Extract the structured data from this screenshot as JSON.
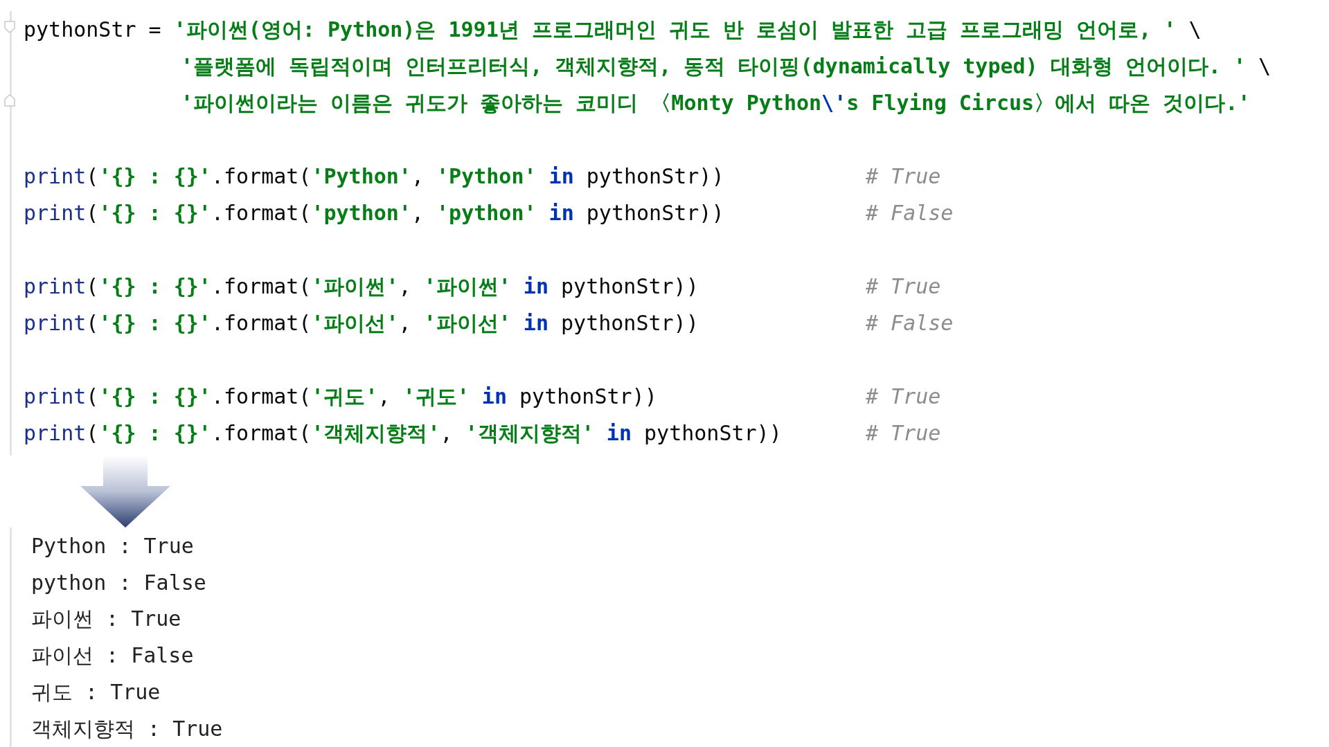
{
  "editor": {
    "blocks": [
      {
        "lines": [
          {
            "fold_start": true,
            "tokens": [
              {
                "kind": "plain",
                "text": "pythonStr = "
              },
              {
                "kind": "string",
                "text": "'파이썬(영어: Python)은 1991년 프로그래머인 귀도 반 로섬이 발표한 고급 프로그래밍 언어로, '"
              },
              {
                "kind": "plain",
                "text": " \\"
              }
            ],
            "children": [
              {
                "tokens": [
                  {
                    "kind": "string",
                    "text": "'플랫폼에 독립적이며 인터프리터식, 객체지향적, 동적 타이핑(dynamically typed) 대화형 언어이다. '"
                  },
                  {
                    "kind": "plain",
                    "text": " \\"
                  }
                ]
              },
              {
                "fold_end": true,
                "tokens": [
                  {
                    "kind": "string",
                    "text": "'파이썬이라는 이름은 귀도가 좋아하는 코미디 〈Monty Python"
                  },
                  {
                    "kind": "escape",
                    "text": "\\'"
                  },
                  {
                    "kind": "string",
                    "text": "s Flying Circus〉에서 따온 것이다.'"
                  }
                ]
              }
            ]
          }
        ]
      },
      {
        "lines": [
          {
            "tokens": [
              {
                "kind": "builtin",
                "text": "print"
              },
              {
                "kind": "plain",
                "text": "("
              },
              {
                "kind": "string",
                "text": "'{} : {}'"
              },
              {
                "kind": "plain",
                "text": ".format("
              },
              {
                "kind": "string",
                "text": "'Python'"
              },
              {
                "kind": "plain",
                "text": ", "
              },
              {
                "kind": "string",
                "text": "'Python'"
              },
              {
                "kind": "keyword",
                "text": " in"
              },
              {
                "kind": "plain",
                "text": " pythonStr))"
              }
            ],
            "comment": "# True"
          },
          {
            "tokens": [
              {
                "kind": "builtin",
                "text": "print"
              },
              {
                "kind": "plain",
                "text": "("
              },
              {
                "kind": "string",
                "text": "'{} : {}'"
              },
              {
                "kind": "plain",
                "text": ".format("
              },
              {
                "kind": "string",
                "text": "'python'"
              },
              {
                "kind": "plain",
                "text": ", "
              },
              {
                "kind": "string",
                "text": "'python'"
              },
              {
                "kind": "keyword",
                "text": " in"
              },
              {
                "kind": "plain",
                "text": " pythonStr))"
              }
            ],
            "comment": "# False"
          }
        ]
      },
      {
        "lines": [
          {
            "tokens": [
              {
                "kind": "builtin",
                "text": "print"
              },
              {
                "kind": "plain",
                "text": "("
              },
              {
                "kind": "string",
                "text": "'{} : {}'"
              },
              {
                "kind": "plain",
                "text": ".format("
              },
              {
                "kind": "string",
                "text": "'파이썬'"
              },
              {
                "kind": "plain",
                "text": ", "
              },
              {
                "kind": "string",
                "text": "'파이썬'"
              },
              {
                "kind": "keyword",
                "text": " in"
              },
              {
                "kind": "plain",
                "text": " pythonStr))"
              }
            ],
            "comment": "# True"
          },
          {
            "tokens": [
              {
                "kind": "builtin",
                "text": "print"
              },
              {
                "kind": "plain",
                "text": "("
              },
              {
                "kind": "string",
                "text": "'{} : {}'"
              },
              {
                "kind": "plain",
                "text": ".format("
              },
              {
                "kind": "string",
                "text": "'파이선'"
              },
              {
                "kind": "plain",
                "text": ", "
              },
              {
                "kind": "string",
                "text": "'파이선'"
              },
              {
                "kind": "keyword",
                "text": " in"
              },
              {
                "kind": "plain",
                "text": " pythonStr))"
              }
            ],
            "comment": "# False"
          }
        ]
      },
      {
        "lines": [
          {
            "tokens": [
              {
                "kind": "builtin",
                "text": "print"
              },
              {
                "kind": "plain",
                "text": "("
              },
              {
                "kind": "string",
                "text": "'{} : {}'"
              },
              {
                "kind": "plain",
                "text": ".format("
              },
              {
                "kind": "string",
                "text": "'귀도'"
              },
              {
                "kind": "plain",
                "text": ", "
              },
              {
                "kind": "string",
                "text": "'귀도'"
              },
              {
                "kind": "keyword",
                "text": " in"
              },
              {
                "kind": "plain",
                "text": " pythonStr))"
              }
            ],
            "comment": "# True"
          },
          {
            "tokens": [
              {
                "kind": "builtin",
                "text": "print"
              },
              {
                "kind": "plain",
                "text": "("
              },
              {
                "kind": "string",
                "text": "'{} : {}'"
              },
              {
                "kind": "plain",
                "text": ".format("
              },
              {
                "kind": "string",
                "text": "'객체지향적'"
              },
              {
                "kind": "plain",
                "text": ", "
              },
              {
                "kind": "string",
                "text": "'객체지향적'"
              },
              {
                "kind": "keyword",
                "text": " in"
              },
              {
                "kind": "plain",
                "text": " pythonStr))"
              }
            ],
            "comment": "# True"
          }
        ]
      }
    ]
  },
  "output": {
    "lines": [
      "Python : True",
      "python : False",
      "파이썬 : True",
      "파이선 : False",
      "귀도 : True",
      "객체지향적 : True"
    ]
  }
}
